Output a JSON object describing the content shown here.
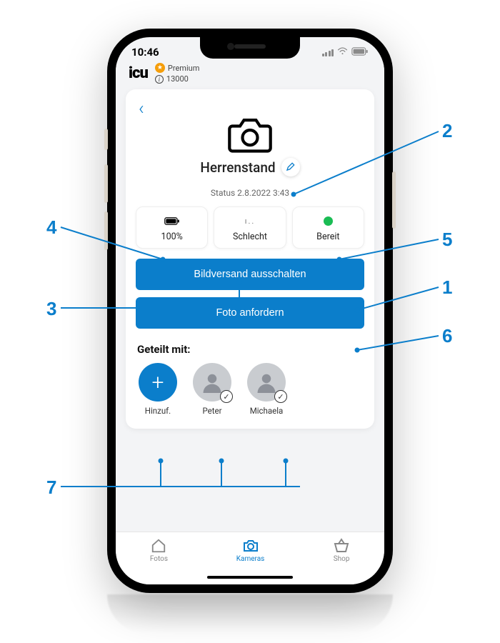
{
  "statusbar": {
    "time": "10:46"
  },
  "header": {
    "logo": "icu",
    "premium_label": "Premium",
    "credits": "13000"
  },
  "camera": {
    "name": "Herrenstand",
    "status_line": "Status 2.8.2022 3:43"
  },
  "stats": {
    "battery": {
      "value": "100%"
    },
    "signal": {
      "value": "Schlecht"
    },
    "state": {
      "value": "Bereit"
    }
  },
  "buttons": {
    "toggle_send": "Bildversand ausschalten",
    "request_photo": "Foto anfordern"
  },
  "shared": {
    "heading": "Geteilt mit:",
    "add_label": "Hinzuf.",
    "users": [
      {
        "name": "Peter"
      },
      {
        "name": "Michaela"
      }
    ]
  },
  "tabs": {
    "fotos": "Fotos",
    "kameras": "Kameras",
    "shop": "Shop"
  },
  "callouts": {
    "c1": "1",
    "c2": "2",
    "c3": "3",
    "c4": "4",
    "c5": "5",
    "c6": "6",
    "c7": "7"
  }
}
